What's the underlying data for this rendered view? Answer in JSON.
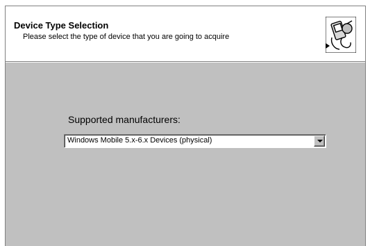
{
  "header": {
    "title": "Device Type Selection",
    "subtitle": "Please select the type of device that you are going to acquire",
    "icon": "mobile-device-wizard-icon"
  },
  "main": {
    "manufacturers_label": "Supported manufacturers:",
    "manufacturer_select": {
      "selected": "Windows Mobile 5.x-6.x Devices (physical)",
      "icon": "chevron-down-icon"
    }
  },
  "colors": {
    "dialog_face": "#c0c0c0",
    "header_background": "#ffffff",
    "border_shadow": "#808080"
  }
}
